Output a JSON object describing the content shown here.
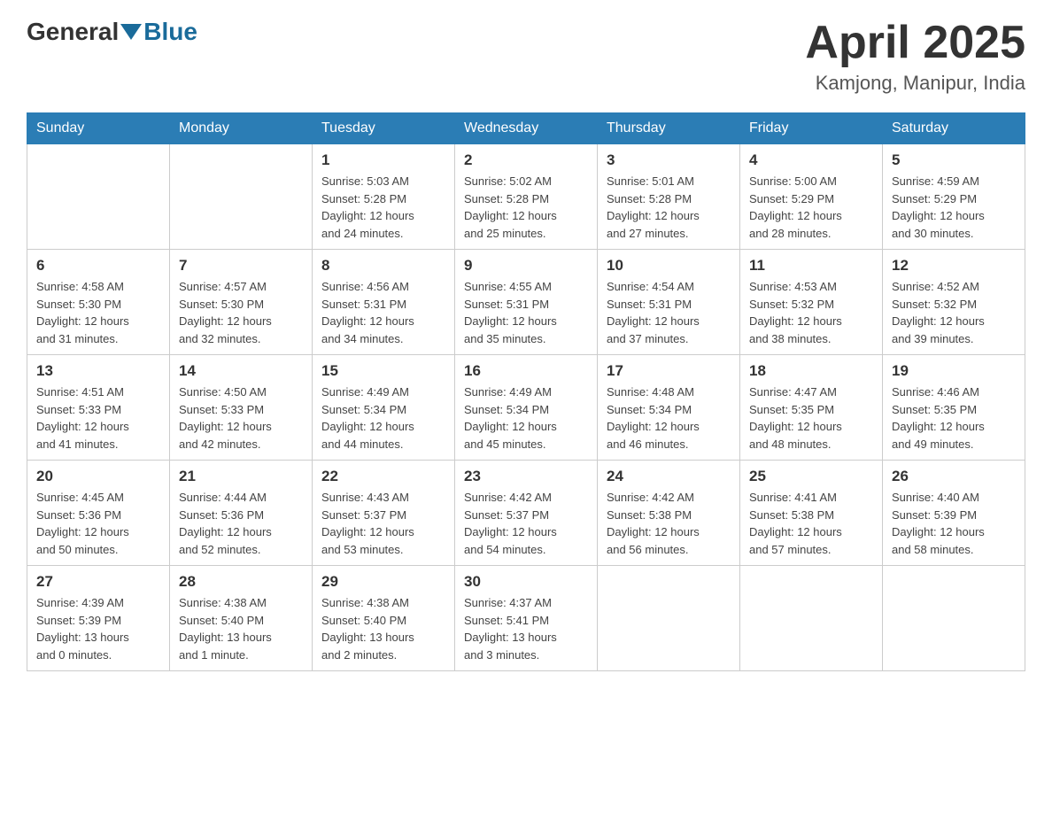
{
  "header": {
    "logo_general": "General",
    "logo_blue": "Blue",
    "title": "April 2025",
    "subtitle": "Kamjong, Manipur, India"
  },
  "days_of_week": [
    "Sunday",
    "Monday",
    "Tuesday",
    "Wednesday",
    "Thursday",
    "Friday",
    "Saturday"
  ],
  "weeks": [
    [
      {
        "day": "",
        "info": ""
      },
      {
        "day": "",
        "info": ""
      },
      {
        "day": "1",
        "info": "Sunrise: 5:03 AM\nSunset: 5:28 PM\nDaylight: 12 hours\nand 24 minutes."
      },
      {
        "day": "2",
        "info": "Sunrise: 5:02 AM\nSunset: 5:28 PM\nDaylight: 12 hours\nand 25 minutes."
      },
      {
        "day": "3",
        "info": "Sunrise: 5:01 AM\nSunset: 5:28 PM\nDaylight: 12 hours\nand 27 minutes."
      },
      {
        "day": "4",
        "info": "Sunrise: 5:00 AM\nSunset: 5:29 PM\nDaylight: 12 hours\nand 28 minutes."
      },
      {
        "day": "5",
        "info": "Sunrise: 4:59 AM\nSunset: 5:29 PM\nDaylight: 12 hours\nand 30 minutes."
      }
    ],
    [
      {
        "day": "6",
        "info": "Sunrise: 4:58 AM\nSunset: 5:30 PM\nDaylight: 12 hours\nand 31 minutes."
      },
      {
        "day": "7",
        "info": "Sunrise: 4:57 AM\nSunset: 5:30 PM\nDaylight: 12 hours\nand 32 minutes."
      },
      {
        "day": "8",
        "info": "Sunrise: 4:56 AM\nSunset: 5:31 PM\nDaylight: 12 hours\nand 34 minutes."
      },
      {
        "day": "9",
        "info": "Sunrise: 4:55 AM\nSunset: 5:31 PM\nDaylight: 12 hours\nand 35 minutes."
      },
      {
        "day": "10",
        "info": "Sunrise: 4:54 AM\nSunset: 5:31 PM\nDaylight: 12 hours\nand 37 minutes."
      },
      {
        "day": "11",
        "info": "Sunrise: 4:53 AM\nSunset: 5:32 PM\nDaylight: 12 hours\nand 38 minutes."
      },
      {
        "day": "12",
        "info": "Sunrise: 4:52 AM\nSunset: 5:32 PM\nDaylight: 12 hours\nand 39 minutes."
      }
    ],
    [
      {
        "day": "13",
        "info": "Sunrise: 4:51 AM\nSunset: 5:33 PM\nDaylight: 12 hours\nand 41 minutes."
      },
      {
        "day": "14",
        "info": "Sunrise: 4:50 AM\nSunset: 5:33 PM\nDaylight: 12 hours\nand 42 minutes."
      },
      {
        "day": "15",
        "info": "Sunrise: 4:49 AM\nSunset: 5:34 PM\nDaylight: 12 hours\nand 44 minutes."
      },
      {
        "day": "16",
        "info": "Sunrise: 4:49 AM\nSunset: 5:34 PM\nDaylight: 12 hours\nand 45 minutes."
      },
      {
        "day": "17",
        "info": "Sunrise: 4:48 AM\nSunset: 5:34 PM\nDaylight: 12 hours\nand 46 minutes."
      },
      {
        "day": "18",
        "info": "Sunrise: 4:47 AM\nSunset: 5:35 PM\nDaylight: 12 hours\nand 48 minutes."
      },
      {
        "day": "19",
        "info": "Sunrise: 4:46 AM\nSunset: 5:35 PM\nDaylight: 12 hours\nand 49 minutes."
      }
    ],
    [
      {
        "day": "20",
        "info": "Sunrise: 4:45 AM\nSunset: 5:36 PM\nDaylight: 12 hours\nand 50 minutes."
      },
      {
        "day": "21",
        "info": "Sunrise: 4:44 AM\nSunset: 5:36 PM\nDaylight: 12 hours\nand 52 minutes."
      },
      {
        "day": "22",
        "info": "Sunrise: 4:43 AM\nSunset: 5:37 PM\nDaylight: 12 hours\nand 53 minutes."
      },
      {
        "day": "23",
        "info": "Sunrise: 4:42 AM\nSunset: 5:37 PM\nDaylight: 12 hours\nand 54 minutes."
      },
      {
        "day": "24",
        "info": "Sunrise: 4:42 AM\nSunset: 5:38 PM\nDaylight: 12 hours\nand 56 minutes."
      },
      {
        "day": "25",
        "info": "Sunrise: 4:41 AM\nSunset: 5:38 PM\nDaylight: 12 hours\nand 57 minutes."
      },
      {
        "day": "26",
        "info": "Sunrise: 4:40 AM\nSunset: 5:39 PM\nDaylight: 12 hours\nand 58 minutes."
      }
    ],
    [
      {
        "day": "27",
        "info": "Sunrise: 4:39 AM\nSunset: 5:39 PM\nDaylight: 13 hours\nand 0 minutes."
      },
      {
        "day": "28",
        "info": "Sunrise: 4:38 AM\nSunset: 5:40 PM\nDaylight: 13 hours\nand 1 minute."
      },
      {
        "day": "29",
        "info": "Sunrise: 4:38 AM\nSunset: 5:40 PM\nDaylight: 13 hours\nand 2 minutes."
      },
      {
        "day": "30",
        "info": "Sunrise: 4:37 AM\nSunset: 5:41 PM\nDaylight: 13 hours\nand 3 minutes."
      },
      {
        "day": "",
        "info": ""
      },
      {
        "day": "",
        "info": ""
      },
      {
        "day": "",
        "info": ""
      }
    ]
  ]
}
